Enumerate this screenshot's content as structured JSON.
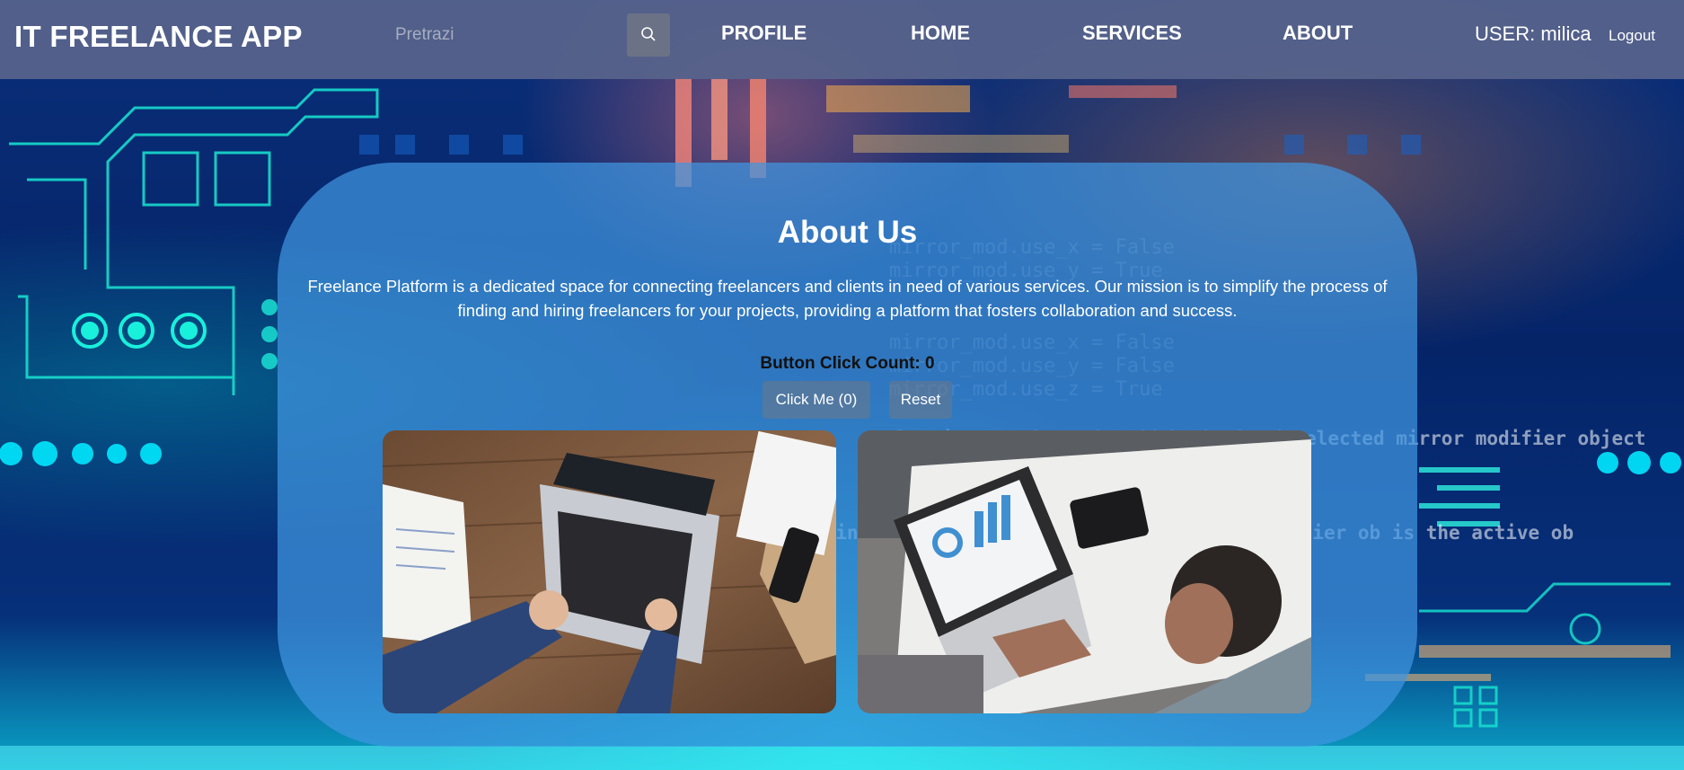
{
  "header": {
    "brand": "IT FREELANCE APP",
    "search_placeholder": "Pretrazi",
    "search_icon": "search-icon",
    "nav": [
      "PROFILE",
      "HOME",
      "SERVICES",
      "ABOUT"
    ],
    "user_label": "USER: milica",
    "logout": "Logout"
  },
  "about": {
    "title": "About Us",
    "description": "Freelance Platform is a dedicated space for connecting freelancers and clients in need of various services. Our mission is to simplify the process of finding and hiring freelancers for your projects, providing a platform that fosters collaboration and success.",
    "click_count_text": "Button Click Count: 0",
    "click_button": "Click Me (0)",
    "reset_button": "Reset"
  },
  "colors": {
    "header_bg": "#58648c",
    "card_bg": "#4096e1",
    "accent_cyan": "#00fff0"
  }
}
